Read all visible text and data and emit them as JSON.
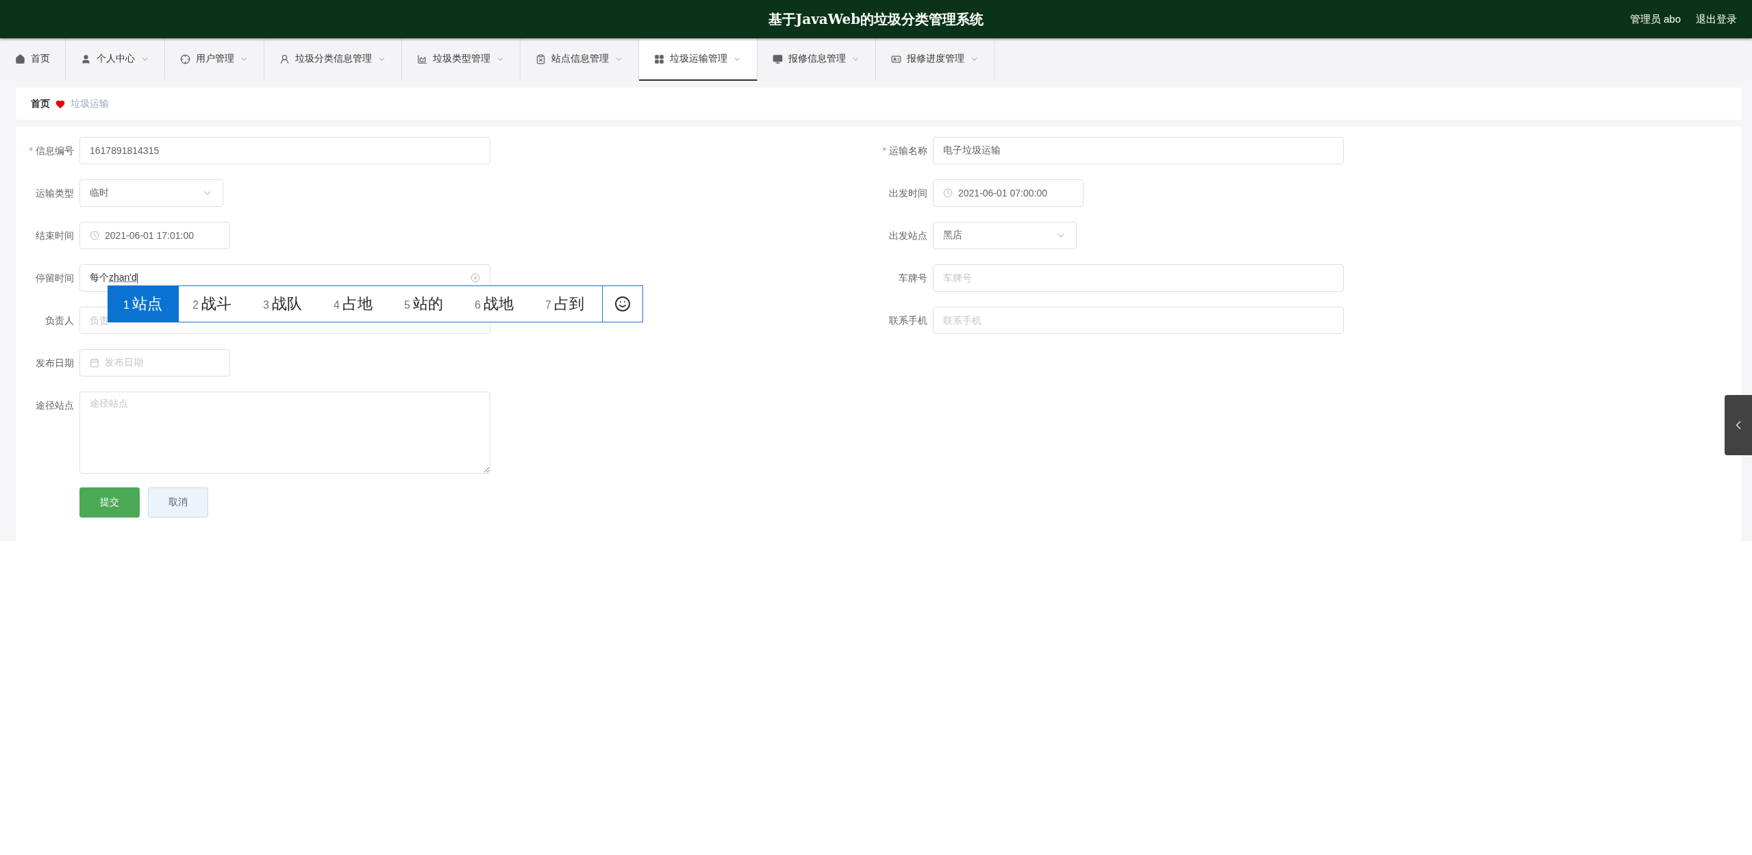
{
  "header": {
    "title": "基于JavaWeb的垃圾分类管理系统",
    "user": "管理员 abo",
    "logout": "退出登录"
  },
  "nav": [
    {
      "label": "首页",
      "selected": false,
      "dropdown": false
    },
    {
      "label": "个人中心",
      "selected": false,
      "dropdown": true
    },
    {
      "label": "用户管理",
      "selected": false,
      "dropdown": true
    },
    {
      "label": "垃圾分类信息管理",
      "selected": false,
      "dropdown": true
    },
    {
      "label": "垃圾类型管理",
      "selected": false,
      "dropdown": true
    },
    {
      "label": "站点信息管理",
      "selected": false,
      "dropdown": true
    },
    {
      "label": "垃圾运输管理",
      "selected": true,
      "dropdown": true
    },
    {
      "label": "报修信息管理",
      "selected": false,
      "dropdown": true
    },
    {
      "label": "报修进度管理",
      "selected": false,
      "dropdown": true
    }
  ],
  "required_mark": "*",
  "breadcrumb": {
    "home": "首页",
    "current": "垃圾运输"
  },
  "form_left": [
    {
      "kind": "text",
      "label": "信息编号",
      "required": true,
      "value": "1617891814315"
    },
    {
      "kind": "select",
      "label": "运输类型",
      "required": false,
      "value": "临时"
    },
    {
      "kind": "datetime",
      "label": "结束时间",
      "required": false,
      "value": "2021-06-01 17:01:00"
    },
    {
      "kind": "composing",
      "label": "停留时间",
      "required": false,
      "value": "每个",
      "composition": "zhan'd"
    },
    {
      "kind": "text",
      "label": "负责人",
      "required": false,
      "placeholder": "负责"
    },
    {
      "kind": "date",
      "label": "发布日期",
      "required": false,
      "placeholder": "发布日期"
    },
    {
      "kind": "textarea",
      "label": "途径站点",
      "required": false,
      "placeholder": "途径站点"
    }
  ],
  "form_right": [
    {
      "kind": "text",
      "label": "运输名称",
      "required": true,
      "value": "电子垃圾运输"
    },
    {
      "kind": "datetime",
      "label": "出发时间",
      "required": false,
      "value": "2021-06-01 07:00:00"
    },
    {
      "kind": "select",
      "label": "出发站点",
      "required": false,
      "value": "黑店"
    },
    {
      "kind": "text",
      "label": "车牌号",
      "required": false,
      "placeholder": "车牌号"
    },
    {
      "kind": "text",
      "label": "联系手机",
      "required": false,
      "placeholder": "联系手机"
    }
  ],
  "buttons": {
    "submit": "提交",
    "cancel": "取消"
  },
  "ime": {
    "candidates": [
      {
        "index": "1",
        "text": "站点",
        "selected": true
      },
      {
        "index": "2",
        "text": "战斗",
        "selected": false
      },
      {
        "index": "3",
        "text": "战队",
        "selected": false
      },
      {
        "index": "4",
        "text": "占地",
        "selected": false
      },
      {
        "index": "5",
        "text": "站的",
        "selected": false
      },
      {
        "index": "6",
        "text": "战地",
        "selected": false
      },
      {
        "index": "7",
        "text": "占到",
        "selected": false
      }
    ]
  }
}
